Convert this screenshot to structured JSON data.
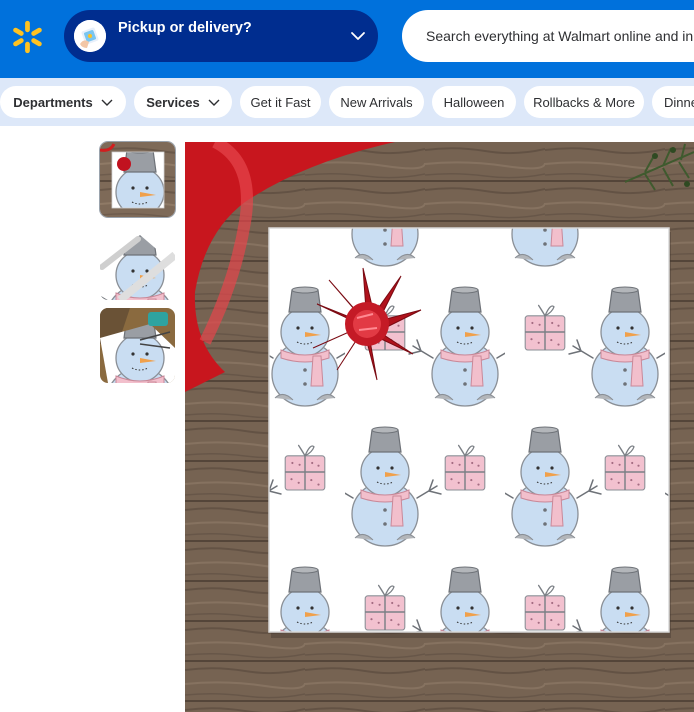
{
  "header": {
    "logo_icon": "walmart-spark-icon",
    "pickup": {
      "label": "Pickup or delivery?",
      "icon": "store-location-icon",
      "chevron": "chevron-down-icon"
    },
    "search": {
      "placeholder": "Search everything at Walmart online and in store"
    },
    "colors": {
      "brand_blue": "#0071dc",
      "pickup_bg": "#002d8f",
      "spark_yellow": "#ffc220"
    }
  },
  "nav": {
    "chips": [
      {
        "label": "Departments",
        "has_chevron": true,
        "bold": true
      },
      {
        "label": "Services",
        "has_chevron": true,
        "bold": true
      },
      {
        "label": "Get it Fast"
      },
      {
        "label": "New Arrivals"
      },
      {
        "label": "Halloween"
      },
      {
        "label": "Rollbacks & More"
      },
      {
        "label": "Dinner Made Easy"
      }
    ]
  },
  "product": {
    "thumbnails": [
      {
        "name": "thumbnail-flat-square-bow",
        "selected": true
      },
      {
        "name": "thumbnail-rolled-paper"
      },
      {
        "name": "thumbnail-wrapping-table"
      }
    ],
    "main_image": "snowman-wrapping-paper-with-red-bow"
  }
}
